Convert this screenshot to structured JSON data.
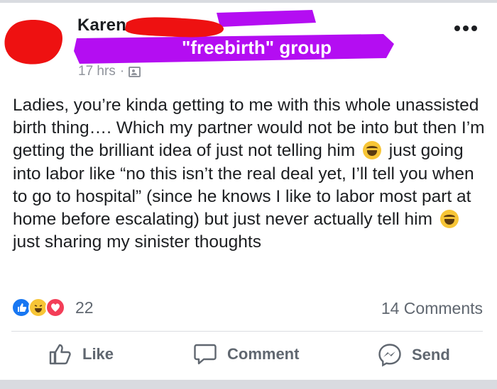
{
  "post": {
    "author": "Karen",
    "group": "\"freebirth\" group",
    "time": "17 hrs",
    "time_separator": "·",
    "privacy_icon": "friends-icon",
    "text": "Ladies, you’re kinda getting to me with this whole unassisted birth thing…. Which my partner would not be into but then I’m getting the brilliant idea of just not telling him",
    "text_2": "just going into labor like “no this isn’t the real deal yet, I’ll tell you when to go to hospital” (since he knows I like to labor most part at home before escalating) but just never actually tell him",
    "text_3": "just sharing my sinister thoughts",
    "emoji": "laughing-crying-emoji"
  },
  "reactions": {
    "types": [
      "like",
      "haha",
      "love"
    ],
    "count": "22",
    "comments": "14 Comments"
  },
  "actions": {
    "like": "Like",
    "comment": "Comment",
    "send": "Send"
  },
  "colors": {
    "redaction_red": "#ee1111",
    "redaction_purple": "#b40df2",
    "text": "#1c1e21",
    "muted": "#606770",
    "like_blue": "#1877f2",
    "love_red": "#f33e58",
    "haha_yellow": "#f7c536"
  }
}
